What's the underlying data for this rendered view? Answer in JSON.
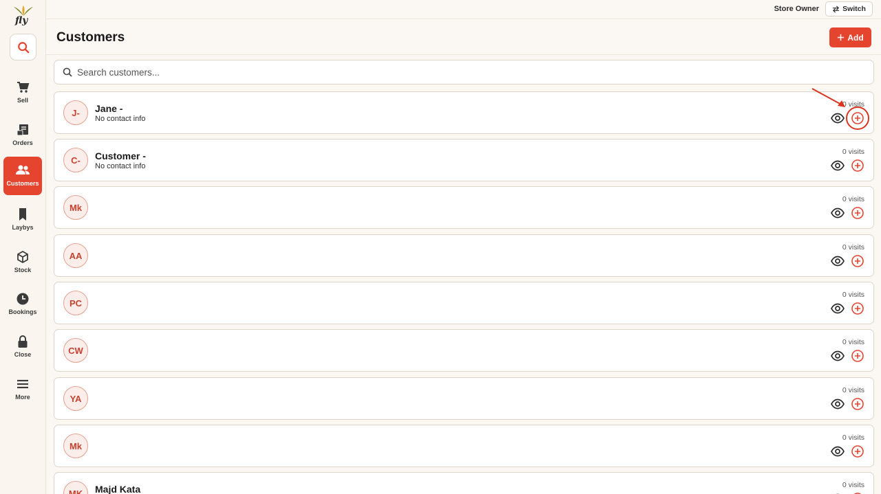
{
  "app": {
    "logo_text": "fly"
  },
  "topbar": {
    "role": "Store Owner",
    "switch_label": "Switch"
  },
  "header": {
    "title": "Customers",
    "add_label": "Add"
  },
  "search": {
    "placeholder": "Search customers..."
  },
  "sidebar": {
    "items": [
      {
        "label": "Sell",
        "icon": "cart-icon"
      },
      {
        "label": "Orders",
        "icon": "receipt-icon"
      },
      {
        "label": "Customers",
        "icon": "users-icon",
        "active": true
      },
      {
        "label": "Laybys",
        "icon": "bookmark-icon"
      },
      {
        "label": "Stock",
        "icon": "box-icon"
      },
      {
        "label": "Bookings",
        "icon": "clock-icon"
      },
      {
        "label": "Close",
        "icon": "lock-icon"
      },
      {
        "label": "More",
        "icon": "menu-icon"
      }
    ]
  },
  "customers": [
    {
      "initials": "J-",
      "name": "Jane -",
      "contact": "No contact info",
      "visits": "0 visits"
    },
    {
      "initials": "C-",
      "name": "Customer -",
      "contact": "No contact info",
      "visits": "0 visits"
    },
    {
      "initials": "Mk",
      "name": "",
      "contact": "",
      "visits": "0 visits"
    },
    {
      "initials": "AA",
      "name": "",
      "contact": "",
      "visits": "0 visits"
    },
    {
      "initials": "PC",
      "name": "",
      "contact": "",
      "visits": "0 visits"
    },
    {
      "initials": "CW",
      "name": "",
      "contact": "",
      "visits": "0 visits"
    },
    {
      "initials": "YA",
      "name": "",
      "contact": "",
      "visits": "0 visits"
    },
    {
      "initials": "Mk",
      "name": "",
      "contact": "",
      "visits": "0 visits"
    },
    {
      "initials": "MK",
      "name": "Majd Kata",
      "contact": "",
      "visits": "0 visits"
    }
  ],
  "colors": {
    "accent": "#e5442f",
    "background": "#fbf8f3"
  }
}
